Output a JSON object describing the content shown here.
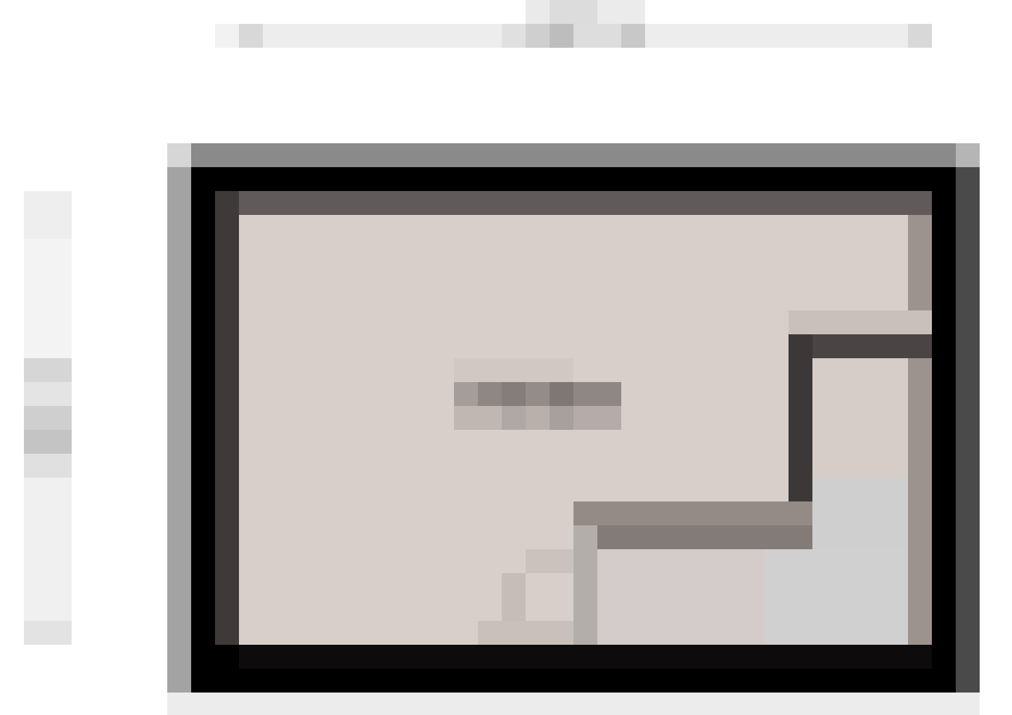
{
  "diagram": {
    "type": "floor-plan",
    "colors": {
      "wall": "#000000",
      "floor": "#d8cfcb",
      "frame_shadow": "#8a8a8a",
      "partition": "#4a4444",
      "dimension_bar": "#ededed"
    },
    "room_label": ""
  }
}
